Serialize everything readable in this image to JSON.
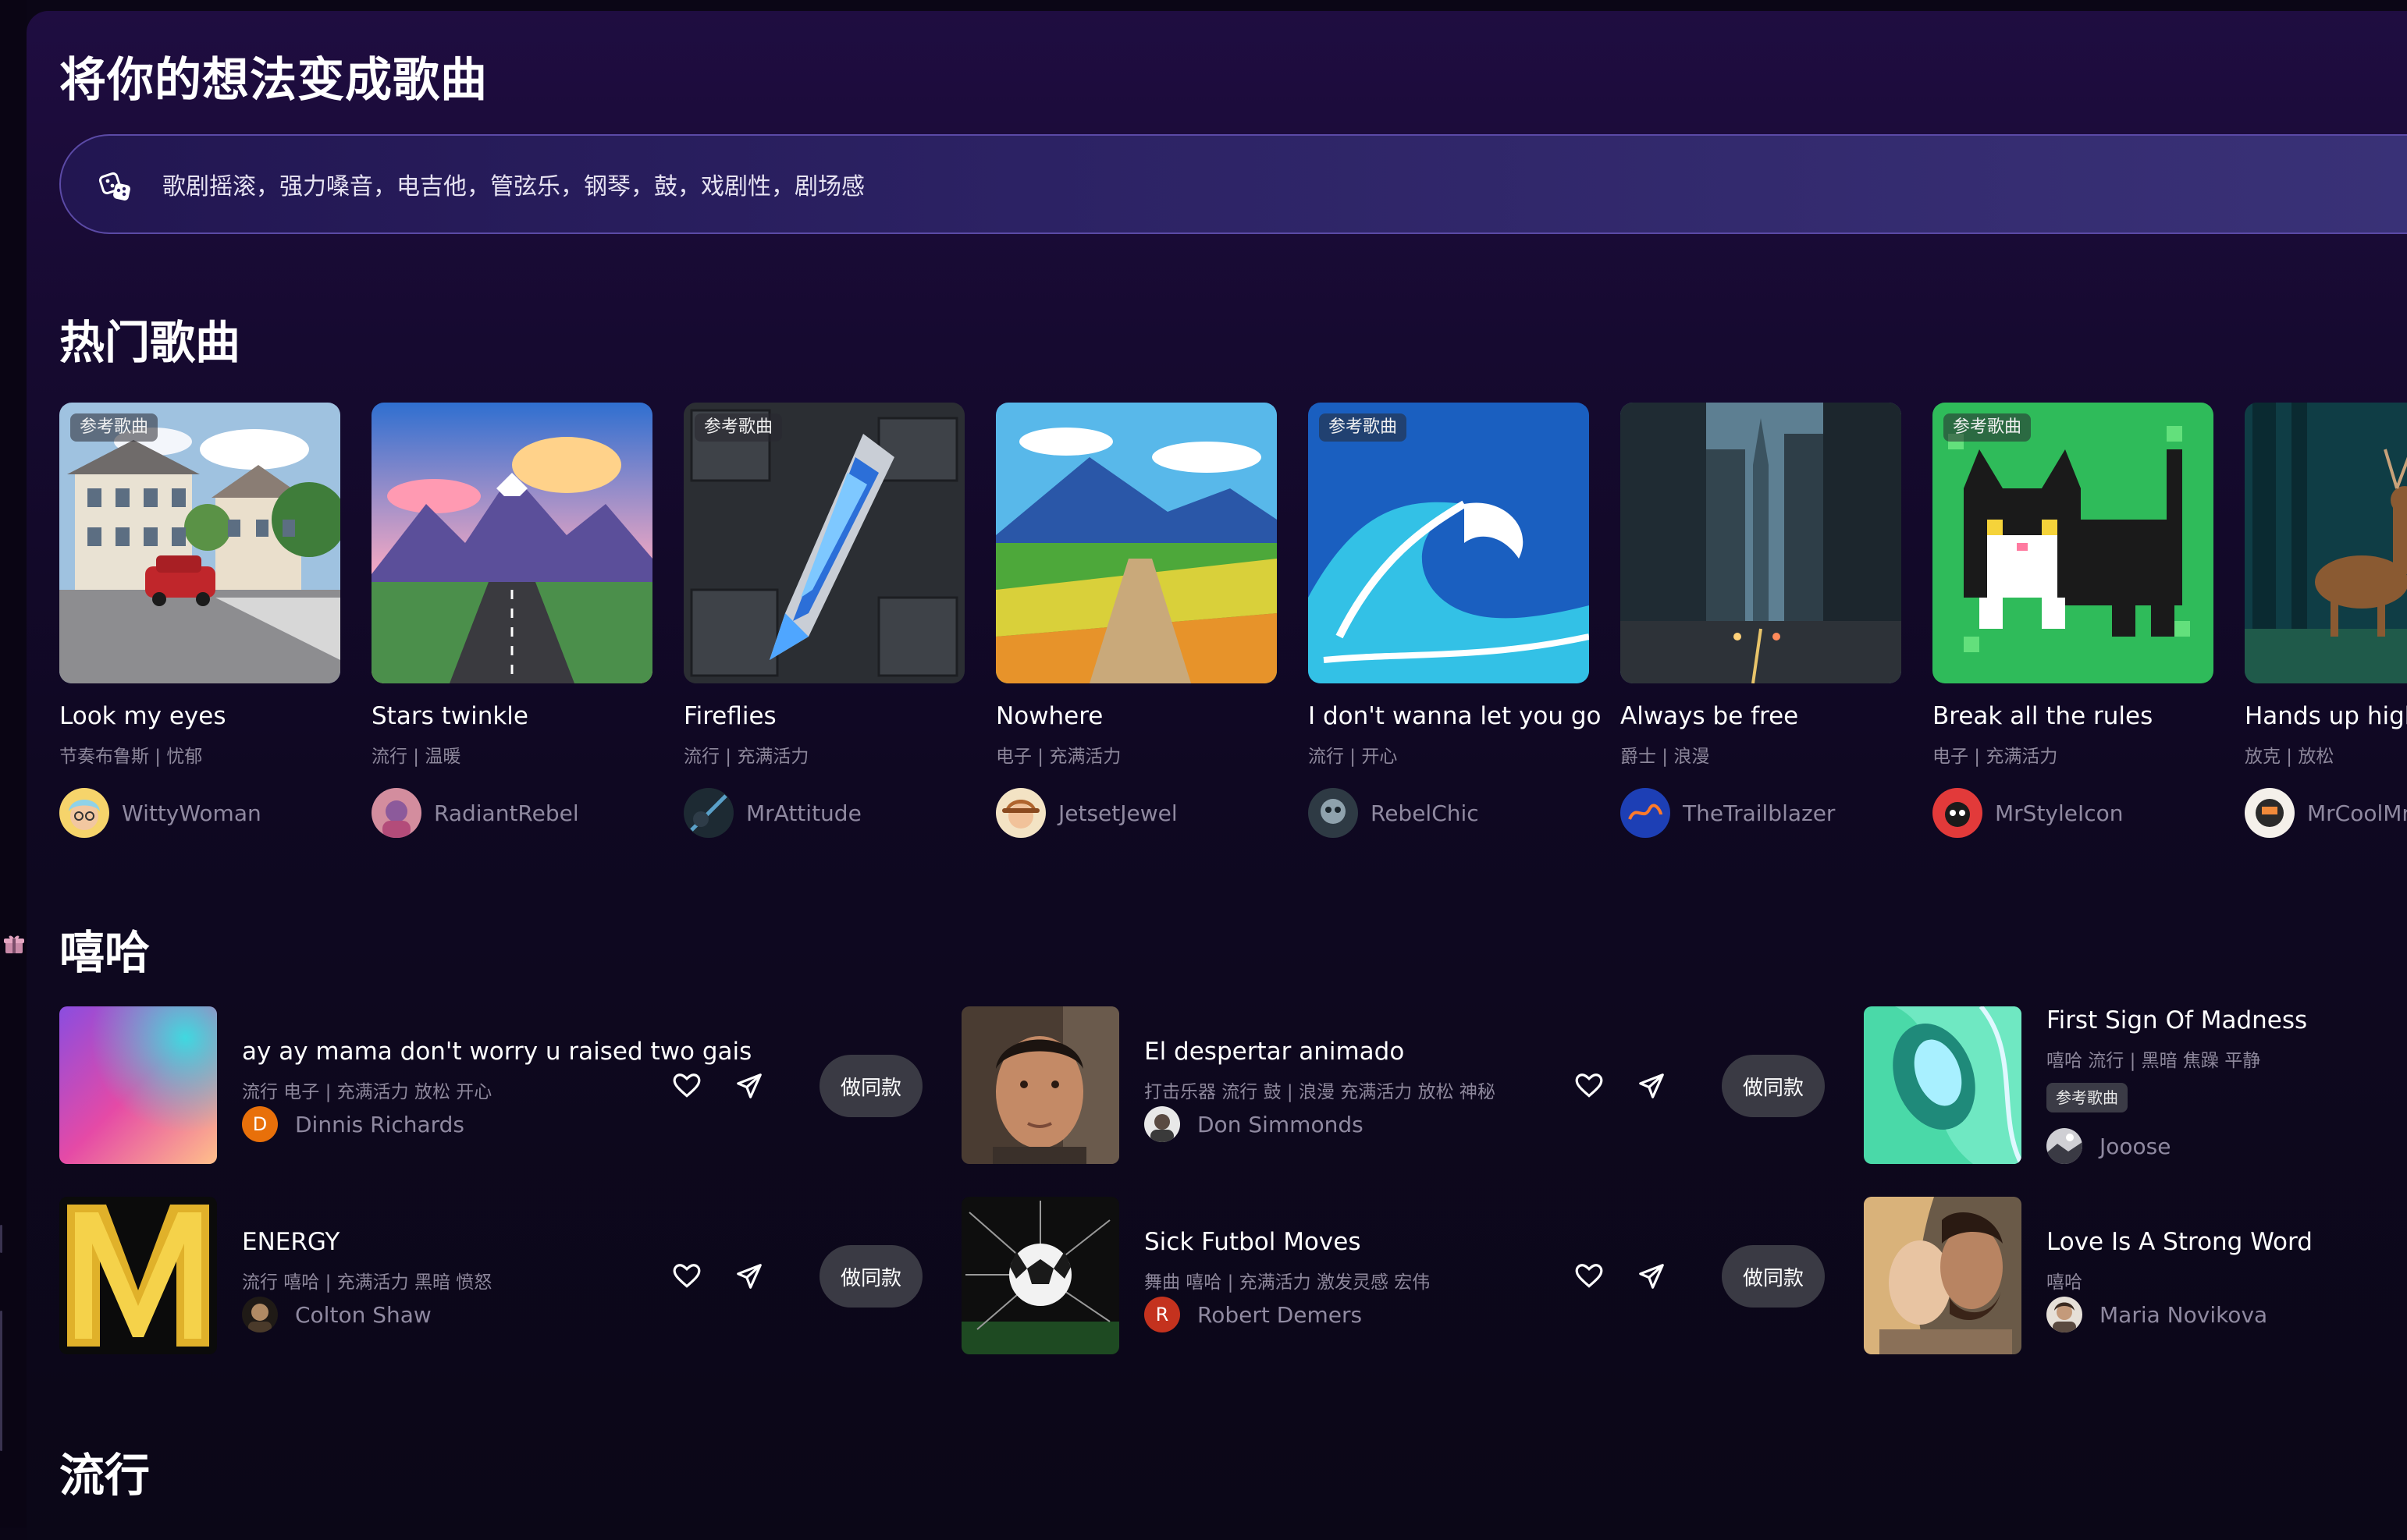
{
  "page": {
    "title": "将你的想法变成歌曲",
    "search": {
      "value": "歌剧摇滚，强力嗓音，电吉他，管弦乐，钢琴，鼓，戏剧性，剧场感",
      "icon": "dice-icon"
    }
  },
  "popular": {
    "title": "热门歌曲",
    "ref_badge": "参考歌曲",
    "cards": [
      {
        "title": "Look my eyes",
        "tags": "节奏布鲁斯 | 忧郁",
        "author": "WittyWoman",
        "ref": true
      },
      {
        "title": "Stars twinkle",
        "tags": "流行 | 温暖",
        "author": "RadiantRebel",
        "ref": false
      },
      {
        "title": "Fireflies",
        "tags": "流行 | 充满活力",
        "author": "MrAttitude",
        "ref": true
      },
      {
        "title": "Nowhere",
        "tags": "电子 | 充满活力",
        "author": "JetsetJewel",
        "ref": false
      },
      {
        "title": "I don't wanna let you go",
        "tags": "流行 | 开心",
        "author": "RebelChic",
        "ref": true
      },
      {
        "title": "Always be free",
        "tags": "爵士 | 浪漫",
        "author": "TheTrailblazer",
        "ref": false
      },
      {
        "title": "Break all the rules",
        "tags": "电子 | 充满活力",
        "author": "MrStyleIcon",
        "ref": true
      },
      {
        "title": "Hands up high",
        "tags": "放克 | 放松",
        "author": "MrCoolMr",
        "ref": false
      }
    ]
  },
  "hiphop": {
    "title": "嘻哈",
    "make_label": "做同款",
    "ref_badge": "参考歌曲",
    "items": [
      {
        "title": "ay ay mama don't worry u raised two gais",
        "tags": "流行 电子 | 充满活力 放松 开心",
        "author": "Dinnis Richards",
        "avatar_letter": "D"
      },
      {
        "title": "El despertar animado",
        "tags": "打击乐器 流行 鼓 | 浪漫 充满活力 放松 神秘",
        "author": "Don Simmonds"
      },
      {
        "title": "First Sign Of Madness",
        "tags": "嘻哈 流行 | 黑暗 焦躁 平静",
        "author": "Jooose"
      },
      {
        "title": "ENERGY",
        "tags": "流行 嘻哈 | 充满活力 黑暗 愤怒",
        "author": "Colton Shaw"
      },
      {
        "title": "Sick Futbol Moves",
        "tags": "舞曲 嘻哈 | 充满活力 激发灵感 宏伟",
        "author": "Robert Demers",
        "avatar_letter": "R"
      },
      {
        "title": "Love Is A Strong Word",
        "tags": "嘻哈",
        "author": "Maria Novikova"
      }
    ]
  },
  "pop": {
    "title": "流行"
  },
  "icons": {
    "like": "heart-icon",
    "share": "send-icon",
    "gift": "gift-icon"
  },
  "colors": {
    "background": "#0b0616",
    "panel_top": "#1f0d41",
    "search_border": "#5b4aa6",
    "muted_text": "#8d879b",
    "button_bg": "#3a3a44"
  }
}
